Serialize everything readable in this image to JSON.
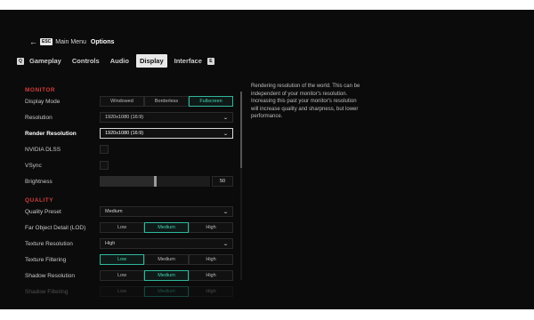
{
  "breadcrumb": {
    "back_key": "ESC",
    "parent": "Main Menu",
    "current": "Options"
  },
  "tabs": {
    "prev_key": "Q",
    "next_key": "E",
    "items": [
      {
        "label": "Gameplay"
      },
      {
        "label": "Controls"
      },
      {
        "label": "Audio"
      },
      {
        "label": "Display"
      },
      {
        "label": "Interface"
      }
    ],
    "active": "Display"
  },
  "sections": {
    "monitor": {
      "title": "MONITOR",
      "display_mode": {
        "label": "Display Mode",
        "options": [
          "Windowed",
          "Borderless",
          "Fullscreen"
        ],
        "selected": "Fullscreen"
      },
      "resolution": {
        "label": "Resolution",
        "value": "1920x1080 (16:9)"
      },
      "render_resolution": {
        "label": "Render Resolution",
        "value": "1920x1080 (16:9)"
      },
      "dlss": {
        "label": "NVIDIA DLSS",
        "checked": false
      },
      "vsync": {
        "label": "VSync",
        "checked": false
      },
      "brightness": {
        "label": "Brightness",
        "value": "50",
        "level": 0.5
      }
    },
    "quality": {
      "title": "QUALITY",
      "preset": {
        "label": "Quality Preset",
        "value": "Medium"
      },
      "lod": {
        "label": "Far Object Detail (LOD)",
        "options": [
          "Low",
          "Medium",
          "High"
        ],
        "selected": "Medium"
      },
      "texture_resolution": {
        "label": "Texture Resolution",
        "value": "High"
      },
      "texture_filtering": {
        "label": "Texture Filtering",
        "options": [
          "Low",
          "Medium",
          "High"
        ],
        "selected": "Low"
      },
      "shadow_resolution": {
        "label": "Shadow Resolution",
        "options": [
          "Low",
          "Medium",
          "High"
        ],
        "selected": "Medium"
      },
      "shadow_filtering": {
        "label": "Shadow Filtering",
        "options": [
          "Low",
          "Medium",
          "High"
        ],
        "selected": "Medium"
      }
    }
  },
  "description": "Rendering resolution of the world. This can be independent of your monitor's resolution. Increasing this past your monitor's resolution will increase quality and sharpness, but lower performance.",
  "colors": {
    "accent": "#2fb79b",
    "section_header": "#d23c3c",
    "background": "#0b0b0b"
  }
}
